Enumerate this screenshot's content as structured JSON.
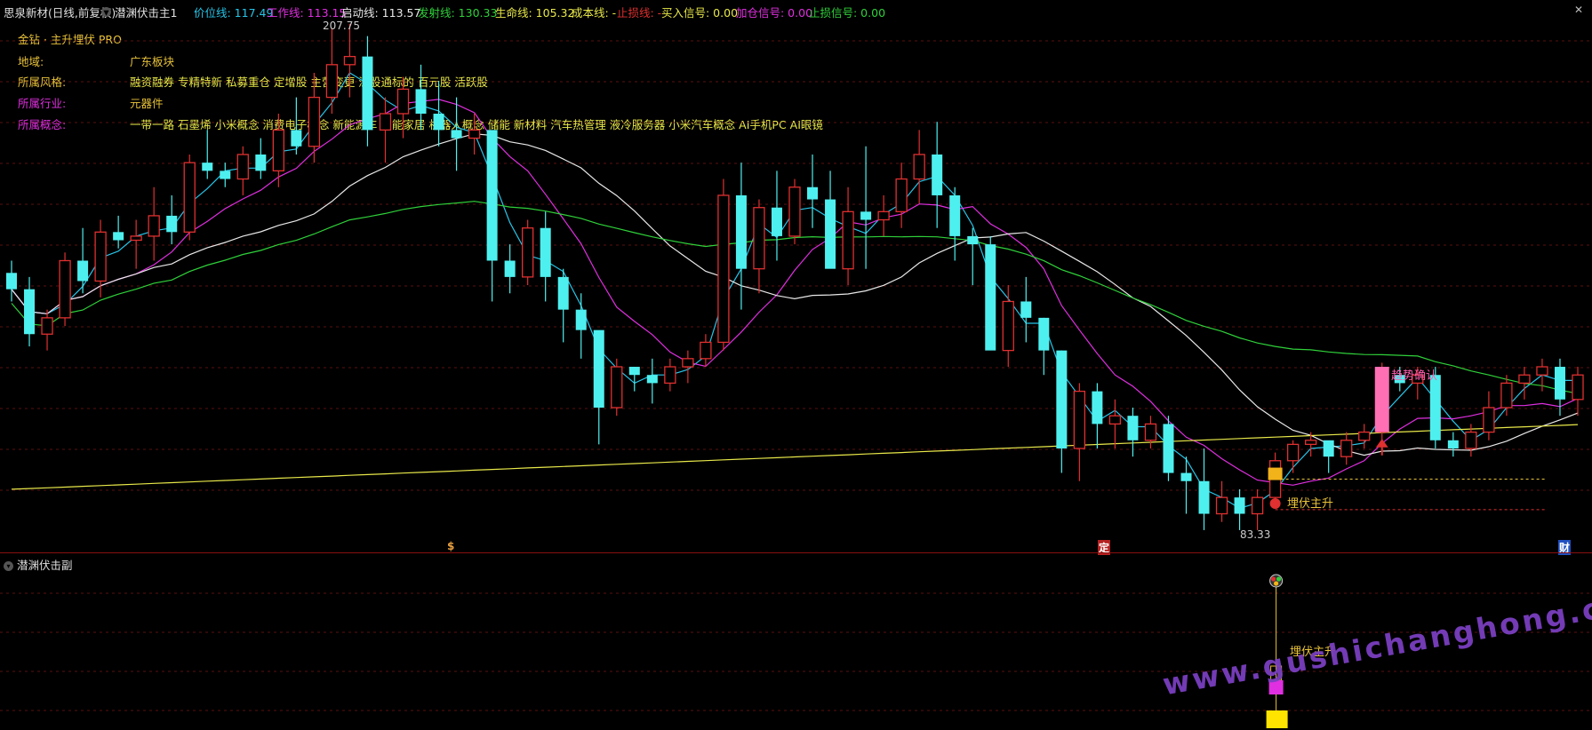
{
  "topbar": {
    "stock": "思泉新材(日线,前复权)",
    "indicator": "潜渊伏击主1",
    "items": [
      {
        "label": "价位线: 117.49",
        "color": "#27c5e8"
      },
      {
        "label": "工作线: 113.15",
        "color": "#e02fe0"
      },
      {
        "label": "启动线: 113.57",
        "color": "#e8e8e8"
      },
      {
        "label": "发射线: 130.33",
        "color": "#2fd13a"
      },
      {
        "label": "生命线: 105.32",
        "color": "#e8e84a"
      },
      {
        "label": "成本线: -",
        "color": "#e8e84a"
      },
      {
        "label": "止损线: -",
        "color": "#e03030"
      },
      {
        "label": "买入信号: 0.00",
        "color": "#e8e84a"
      },
      {
        "label": "加仓信号: 0.00",
        "color": "#e02fe0"
      },
      {
        "label": "止损信号: 0.00",
        "color": "#2fd13a"
      }
    ]
  },
  "info": {
    "brand": "金钻 · 主升埋伏 PRO",
    "region_label": "地域:",
    "region_value": "广东板块",
    "style_label": "所属风格:",
    "style_value": "融资融券 专精特新 私募重仓 定增股 主营变更 深股通标的 百元股 活跃股",
    "industry_label": "所属行业:",
    "industry_value": "元器件",
    "concept_label": "所属概念:",
    "concept_value": "一带一路 石墨烯 小米概念 消费电子概念 新能源车 智能家居 机器人概念 储能 新材料 汽车热管理 液冷服务器 小米汽车概念 AI手机PC AI眼镜"
  },
  "annotations": {
    "high_label": "207.75",
    "low_label": "83.33",
    "trend_confirm": "趋势确认",
    "ambush_main": "埋伏主升",
    "ambush_sub": "埋伏主升",
    "marker_dollar": "$",
    "marker_ding": "定",
    "marker_cai": "财"
  },
  "sub_panel": {
    "title": "潜渊伏击副"
  },
  "watermark": "www.gushichanghong.com",
  "colors": {
    "up": "#e03030",
    "down": "#4ef0ef",
    "ma_fast": "#27c5e8",
    "ma_mid": "#e02fe0",
    "ma_slow": "#e8e8e8",
    "ma_long": "#2fd13a",
    "ma_life": "#e8e84a",
    "grid": "#5a0f0f",
    "signal": "#ffe400"
  },
  "chart_data": {
    "type": "candlestick",
    "ylim": [
      83.33,
      207.75
    ],
    "high": 207.75,
    "low": 83.33,
    "candles": [
      [
        147,
        150,
        140,
        143
      ],
      [
        143,
        146,
        129,
        132
      ],
      [
        132,
        138,
        128,
        136
      ],
      [
        136,
        152,
        134,
        150
      ],
      [
        150,
        158,
        142,
        145
      ],
      [
        145,
        160,
        141,
        157
      ],
      [
        157,
        161,
        153,
        155
      ],
      [
        155,
        160,
        148,
        156
      ],
      [
        156,
        168,
        150,
        161
      ],
      [
        161,
        166,
        154,
        157
      ],
      [
        157,
        176,
        155,
        174
      ],
      [
        174,
        182,
        170,
        172
      ],
      [
        172,
        174,
        168,
        170
      ],
      [
        170,
        178,
        166,
        176
      ],
      [
        176,
        180,
        170,
        172
      ],
      [
        172,
        186,
        168,
        182
      ],
      [
        182,
        190,
        176,
        178
      ],
      [
        178,
        196,
        174,
        190
      ],
      [
        190,
        207,
        186,
        198
      ],
      [
        198,
        208,
        190,
        200
      ],
      [
        200,
        205,
        178,
        182
      ],
      [
        182,
        190,
        174,
        186
      ],
      [
        186,
        195,
        180,
        192
      ],
      [
        192,
        198,
        182,
        186
      ],
      [
        186,
        194,
        178,
        182
      ],
      [
        182,
        190,
        172,
        180
      ],
      [
        180,
        186,
        176,
        182
      ],
      [
        182,
        178,
        140,
        150
      ],
      [
        150,
        154,
        142,
        146
      ],
      [
        146,
        160,
        144,
        158
      ],
      [
        158,
        162,
        140,
        146
      ],
      [
        146,
        148,
        130,
        138
      ],
      [
        138,
        142,
        126,
        133
      ],
      [
        133,
        126,
        105,
        114
      ],
      [
        114,
        126,
        112,
        124
      ],
      [
        124,
        124,
        118,
        122
      ],
      [
        122,
        126,
        115,
        120
      ],
      [
        120,
        126,
        118,
        124
      ],
      [
        124,
        128,
        120,
        126
      ],
      [
        126,
        132,
        124,
        130
      ],
      [
        130,
        170,
        128,
        166
      ],
      [
        166,
        174,
        138,
        148
      ],
      [
        148,
        165,
        142,
        163
      ],
      [
        163,
        172,
        150,
        156
      ],
      [
        156,
        170,
        154,
        168
      ],
      [
        168,
        176,
        158,
        165
      ],
      [
        165,
        172,
        152,
        148
      ],
      [
        148,
        168,
        144,
        162
      ],
      [
        162,
        178,
        148,
        160
      ],
      [
        160,
        166,
        156,
        162
      ],
      [
        162,
        174,
        158,
        170
      ],
      [
        170,
        182,
        164,
        176
      ],
      [
        176,
        184,
        158,
        166
      ],
      [
        166,
        168,
        150,
        156
      ],
      [
        156,
        158,
        144,
        154
      ],
      [
        154,
        156,
        135,
        128
      ],
      [
        128,
        144,
        124,
        140
      ],
      [
        140,
        146,
        130,
        136
      ],
      [
        136,
        136,
        122,
        128
      ],
      [
        128,
        128,
        98,
        104
      ],
      [
        104,
        120,
        96,
        118
      ],
      [
        118,
        120,
        104,
        110
      ],
      [
        110,
        116,
        104,
        112
      ],
      [
        112,
        114,
        102,
        106
      ],
      [
        106,
        112,
        104,
        110
      ],
      [
        110,
        112,
        96,
        98
      ],
      [
        98,
        102,
        88,
        96
      ],
      [
        96,
        104,
        84,
        88
      ],
      [
        88,
        96,
        86,
        92
      ],
      [
        92,
        94,
        84,
        88
      ],
      [
        88,
        94,
        84,
        92
      ],
      [
        92,
        103,
        90,
        101
      ],
      [
        101,
        106,
        98,
        105
      ],
      [
        105,
        108,
        102,
        106
      ],
      [
        106,
        104,
        98,
        102
      ],
      [
        102,
        108,
        100,
        106
      ],
      [
        106,
        110,
        104,
        108
      ],
      [
        108,
        125,
        106,
        122
      ],
      [
        122,
        124,
        118,
        120
      ],
      [
        120,
        124,
        116,
        122
      ],
      [
        122,
        124,
        104,
        106
      ],
      [
        106,
        108,
        102,
        104
      ],
      [
        104,
        110,
        102,
        108
      ],
      [
        108,
        118,
        106,
        114
      ],
      [
        114,
        122,
        112,
        120
      ],
      [
        120,
        124,
        116,
        122
      ],
      [
        122,
        126,
        118,
        124
      ],
      [
        124,
        126,
        112,
        116
      ],
      [
        116,
        124,
        112,
        122
      ]
    ]
  }
}
